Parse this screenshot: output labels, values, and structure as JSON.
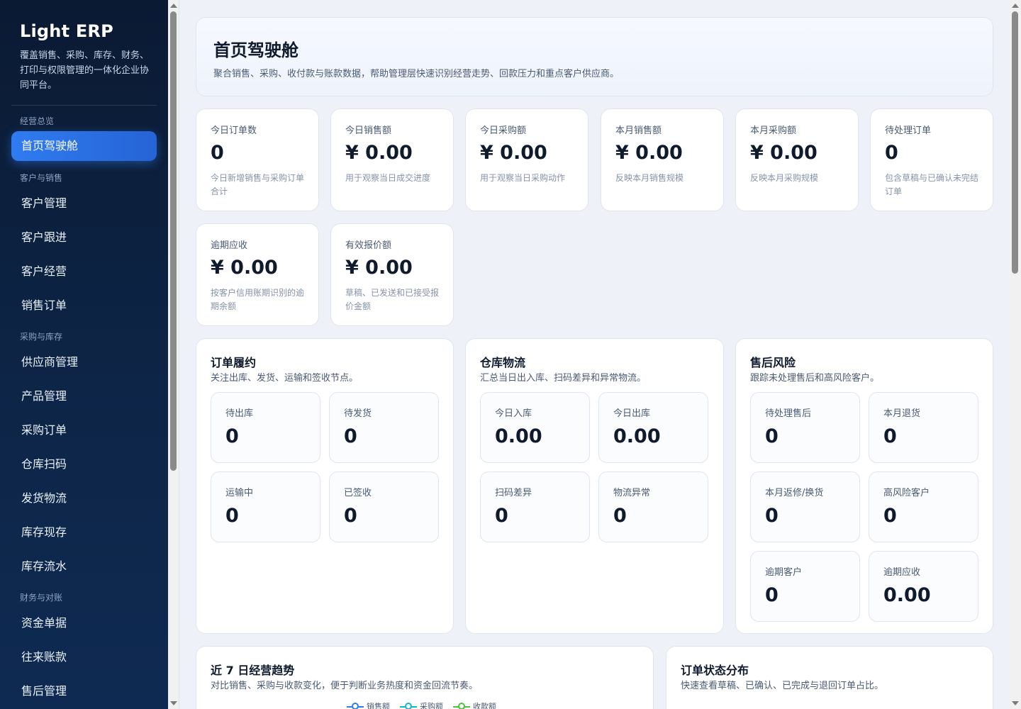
{
  "sidebar": {
    "brand": "Light ERP",
    "description": "覆盖销售、采购、库存、财务、打印与权限管理的一体化企业协同平台。",
    "groups": [
      {
        "label": "经营总览"
      },
      {
        "label": "客户与销售"
      },
      {
        "label": "采购与库存"
      },
      {
        "label": "财务与对账"
      }
    ],
    "items": [
      {
        "label": "首页驾驶舱",
        "active": true
      },
      {
        "label": "客户管理"
      },
      {
        "label": "客户跟进"
      },
      {
        "label": "客户经营"
      },
      {
        "label": "销售订单"
      },
      {
        "label": "供应商管理"
      },
      {
        "label": "产品管理"
      },
      {
        "label": "采购订单"
      },
      {
        "label": "仓库扫码"
      },
      {
        "label": "发货物流"
      },
      {
        "label": "库存现存"
      },
      {
        "label": "库存流水"
      },
      {
        "label": "资金单据"
      },
      {
        "label": "往来账款"
      },
      {
        "label": "售后管理"
      }
    ]
  },
  "hero": {
    "title": "首页驾驶舱",
    "subtitle": "聚合销售、采购、收付款与账款数据，帮助管理层快速识别经营走势、回款压力和重点客户供应商。"
  },
  "stats": [
    {
      "label": "今日订单数",
      "value": "0",
      "hint": "今日新增销售与采购订单合计"
    },
    {
      "label": "今日销售额",
      "value": "¥ 0.00",
      "hint": "用于观察当日成交进度"
    },
    {
      "label": "今日采购额",
      "value": "¥ 0.00",
      "hint": "用于观察当日采购动作"
    },
    {
      "label": "本月销售额",
      "value": "¥ 0.00",
      "hint": "反映本月销售规模"
    },
    {
      "label": "本月采购额",
      "value": "¥ 0.00",
      "hint": "反映本月采购规模"
    },
    {
      "label": "待处理订单",
      "value": "0",
      "hint": "包含草稿与已确认未完结订单"
    },
    {
      "label": "逾期应收",
      "value": "¥ 0.00",
      "hint": "按客户信用账期识别的逾期余额"
    },
    {
      "label": "有效报价额",
      "value": "¥ 0.00",
      "hint": "草稿、已发送和已接受报价金额"
    }
  ],
  "panels": {
    "fulfillment": {
      "title": "订单履约",
      "subtitle": "关注出库、发货、运输和签收节点。",
      "items": [
        {
          "label": "待出库",
          "value": "0"
        },
        {
          "label": "待发货",
          "value": "0"
        },
        {
          "label": "运输中",
          "value": "0"
        },
        {
          "label": "已签收",
          "value": "0"
        }
      ]
    },
    "warehouse": {
      "title": "仓库物流",
      "subtitle": "汇总当日出入库、扫码差异和异常物流。",
      "items": [
        {
          "label": "今日入库",
          "value": "0.00"
        },
        {
          "label": "今日出库",
          "value": "0.00"
        },
        {
          "label": "扫码差异",
          "value": "0"
        },
        {
          "label": "物流异常",
          "value": "0"
        }
      ]
    },
    "aftersales": {
      "title": "售后风险",
      "subtitle": "跟踪未处理售后和高风险客户。",
      "items": [
        {
          "label": "待处理售后",
          "value": "0"
        },
        {
          "label": "本月退货",
          "value": "0"
        },
        {
          "label": "本月返修/换货",
          "value": "0"
        },
        {
          "label": "高风险客户",
          "value": "0"
        },
        {
          "label": "逾期客户",
          "value": "0"
        },
        {
          "label": "逾期应收",
          "value": "0.00"
        }
      ]
    }
  },
  "trend": {
    "title": "近 7 日经营趋势",
    "subtitle": "对比销售、采购与收款变化，便于判断业务热度和资金回流节奏。",
    "legend": [
      {
        "name": "销售额",
        "color": "#2f7cf0"
      },
      {
        "name": "采购额",
        "color": "#14b8c4"
      },
      {
        "name": "收款额",
        "color": "#4cc23a"
      }
    ]
  },
  "status": {
    "title": "订单状态分布",
    "subtitle": "快速查看草稿、已确认、已完成与退回订单占比。"
  }
}
